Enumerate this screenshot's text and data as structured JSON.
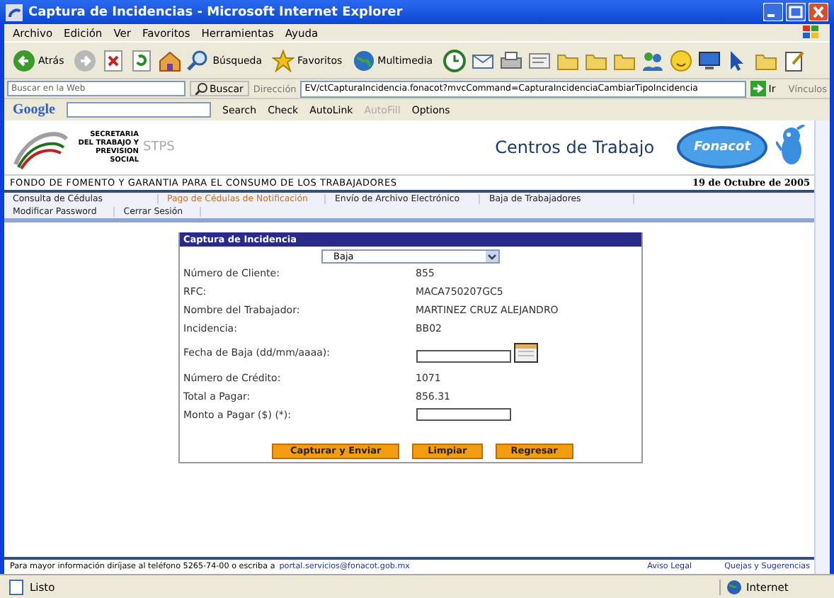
{
  "window": {
    "title": "Captura de Incidencias - Microsoft Internet Explorer"
  },
  "menu": [
    "Archivo",
    "Edición",
    "Ver",
    "Favoritos",
    "Herramientas",
    "Ayuda"
  ],
  "toolbar": [
    {
      "kind": "back",
      "label": "Atrás"
    },
    {
      "kind": "forward"
    },
    {
      "kind": "stop"
    },
    {
      "kind": "refresh"
    },
    {
      "kind": "home"
    },
    {
      "kind": "search",
      "label": "Búsqueda"
    },
    {
      "kind": "star",
      "label": "Favoritos"
    },
    {
      "kind": "globe",
      "label": "Multimedia"
    },
    {
      "kind": "history"
    },
    {
      "kind": "mail"
    },
    {
      "kind": "print"
    },
    {
      "kind": "edit"
    },
    {
      "kind": "folder"
    },
    {
      "kind": "folder"
    },
    {
      "kind": "folder"
    },
    {
      "kind": "people"
    },
    {
      "kind": "smiley"
    },
    {
      "kind": "screen"
    },
    {
      "kind": "cursor"
    },
    {
      "kind": "folder"
    },
    {
      "kind": "note"
    }
  ],
  "search_bar": {
    "placeholder": "Buscar en la Web",
    "button": "Buscar"
  },
  "address": {
    "label": "Dirección",
    "url": "EV/ctCapturaIncidencia.fonacot?mvcCommand=CapturaIncidenciaCambiarTipoIncidencia",
    "go": "Ir",
    "links": "Vínculos"
  },
  "google_bar": {
    "logo": "Google",
    "items": [
      {
        "label": "Search",
        "disabled": false
      },
      {
        "label": "Check",
        "disabled": false
      },
      {
        "label": "AutoLink",
        "disabled": false
      },
      {
        "label": "AutoFill",
        "disabled": true
      },
      {
        "label": "Options",
        "disabled": false
      }
    ]
  },
  "header": {
    "secretaria": "SECRETARIA DEL TRABAJO Y PREVISION SOCIAL",
    "stps": "STPS",
    "title": "Centros de Trabajo",
    "brand": "Fonacot",
    "subtitle": "FONDO DE FOMENTO Y GARANTIA PARA EL CONSUMO DE LOS TRABAJADORES",
    "date": "19 de Octubre de 2005"
  },
  "nav": [
    [
      {
        "label": "Consulta de Cédulas",
        "selected": false
      },
      {
        "label": "Pago de Cédulas de Notificación",
        "selected": true
      },
      {
        "label": "Envío de Archivo Electrónico",
        "selected": false
      },
      {
        "label": "Baja de Trabajadores",
        "selected": false
      }
    ],
    [
      {
        "label": "Modificar Password",
        "selected": false
      },
      {
        "label": "Cerrar Sesión",
        "selected": false
      }
    ]
  ],
  "form": {
    "title": "Captura de Incidencia",
    "type_select": "Baja",
    "fields": [
      {
        "kind": "text",
        "label": "Número de Cliente:",
        "value": "855"
      },
      {
        "kind": "text",
        "label": "RFC:",
        "value": "MACA750207GC5"
      },
      {
        "kind": "text",
        "label": "Nombre del Trabajador:",
        "value": "MARTINEZ CRUZ ALEJANDRO"
      },
      {
        "kind": "text",
        "label": "Incidencia:",
        "value": "BB02"
      },
      {
        "kind": "date",
        "label": "Fecha de Baja (dd/mm/aaaa):"
      },
      {
        "kind": "text",
        "label": "Número de Crédito:",
        "value": "1071"
      },
      {
        "kind": "text",
        "label": "Total a Pagar:",
        "value": "856.31"
      },
      {
        "kind": "input",
        "label": "Monto a Pagar ($) (*):"
      }
    ],
    "buttons": [
      "Capturar y Enviar",
      "Limpiar",
      "Regresar"
    ]
  },
  "footer": {
    "text": "Para mayor información diríjase al teléfono 5265-74-00 o escriba a",
    "email": "portal.servicios@fonacot.gob.mx",
    "links": [
      "Aviso Legal",
      "Quejas y Sugerencias"
    ]
  },
  "status_bar": {
    "text": "Listo",
    "zone": "Internet"
  }
}
